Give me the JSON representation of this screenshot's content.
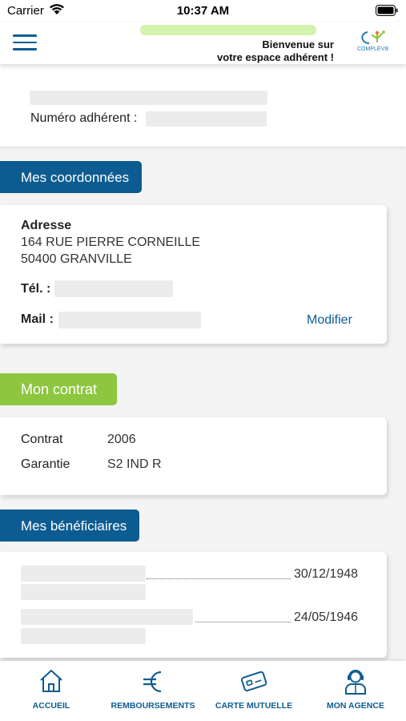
{
  "status_bar": {
    "carrier": "Carrier",
    "time": "10:37 AM"
  },
  "header": {
    "welcome_line1": "Bienvenue sur",
    "welcome_line2": "votre espace adhérent !",
    "logo_text": "COMPLÉVIE"
  },
  "profile": {
    "member_number_label": "Numéro adhérent :"
  },
  "coordonnees": {
    "tab_label": "Mes coordonnées",
    "address_label": "Adresse",
    "address_line1": "164 RUE PIERRE CORNEILLE",
    "address_line2": "50400 GRANVILLE",
    "phone_label": "Tél. :",
    "mail_label": "Mail :",
    "edit_link": "Modifier"
  },
  "contrat": {
    "tab_label": "Mon contrat",
    "rows": [
      {
        "label": "Contrat",
        "value": "2006"
      },
      {
        "label": "Garantie",
        "value": "S2 IND R"
      }
    ]
  },
  "beneficiaires": {
    "tab_label": "Mes bénéficiaires",
    "items": [
      {
        "date": "30/12/1948"
      },
      {
        "date": "24/05/1946"
      }
    ]
  },
  "tab_bar": {
    "items": [
      {
        "label": "ACCUEIL",
        "icon": "home-icon"
      },
      {
        "label": "REMBOURSEMENTS",
        "icon": "euro-icon"
      },
      {
        "label": "CARTE MUTUELLE",
        "icon": "card-icon"
      },
      {
        "label": "MON AGENCE",
        "icon": "agent-icon"
      }
    ]
  },
  "colors": {
    "primary": "#0d5c91",
    "accent_green": "#8dc63f",
    "background": "#f4f4f4"
  }
}
